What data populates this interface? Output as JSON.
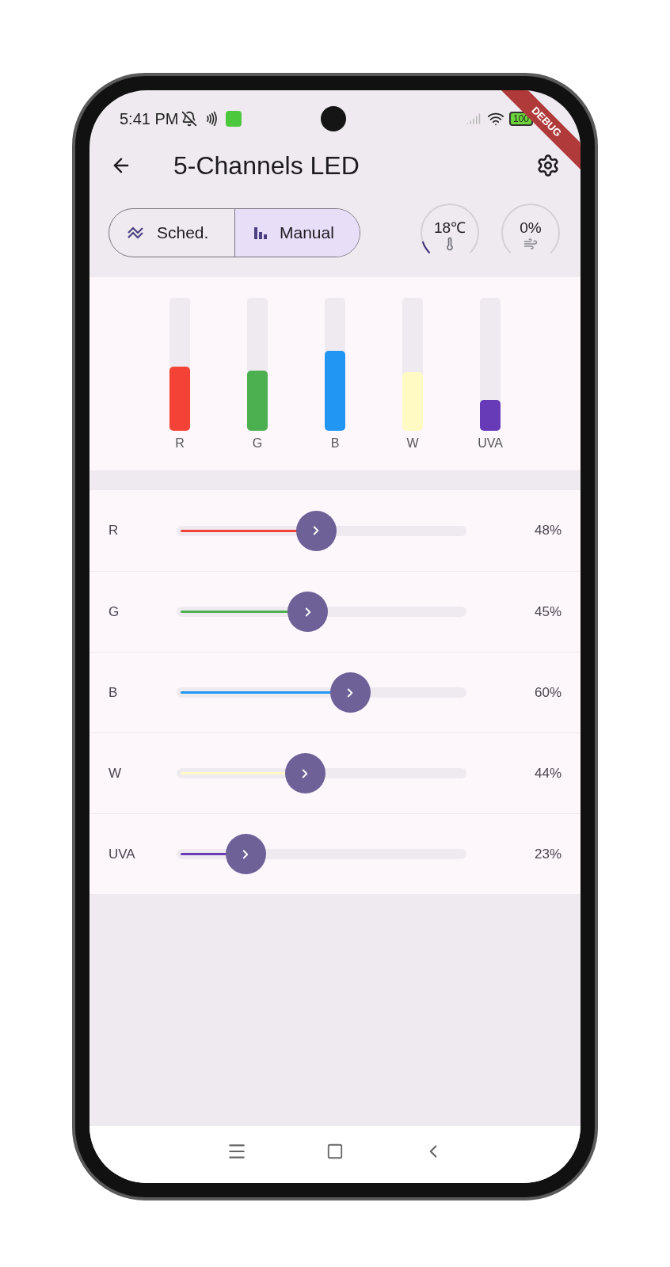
{
  "status_bar": {
    "time": "5:41 PM",
    "battery": "100"
  },
  "debug_banner": "DEBUG",
  "app_bar": {
    "title": "5-Channels LED"
  },
  "mode_tabs": [
    {
      "label": "Sched.",
      "kind": "schedule",
      "selected": false
    },
    {
      "label": "Manual",
      "kind": "manual",
      "selected": true
    }
  ],
  "gauges": [
    {
      "kind": "temperature",
      "reading": "18℃",
      "level": 0.1
    },
    {
      "kind": "fan",
      "reading": "0%"
    }
  ],
  "bars": [
    {
      "label": "R",
      "color": "#f44336",
      "level": 0.48
    },
    {
      "label": "G",
      "color": "#4caf50",
      "level": 0.45
    },
    {
      "label": "B",
      "color": "#2196f3",
      "level": 0.6
    },
    {
      "label": "W",
      "color": "#fff9c4",
      "level": 0.44
    },
    {
      "label": "UVA",
      "color": "#673ab7",
      "level": 0.23
    }
  ],
  "channels": [
    {
      "label": "R",
      "color": "#f44336",
      "level": 0.48,
      "reading": "48%"
    },
    {
      "label": "G",
      "color": "#4caf50",
      "level": 0.45,
      "reading": "45%"
    },
    {
      "label": "B",
      "color": "#2196f3",
      "level": 0.6,
      "reading": "60%"
    },
    {
      "label": "W",
      "color": "#fff9c4",
      "level": 0.44,
      "reading": "44%"
    },
    {
      "label": "UVA",
      "color": "#673ab7",
      "level": 0.23,
      "reading": "23%"
    }
  ]
}
